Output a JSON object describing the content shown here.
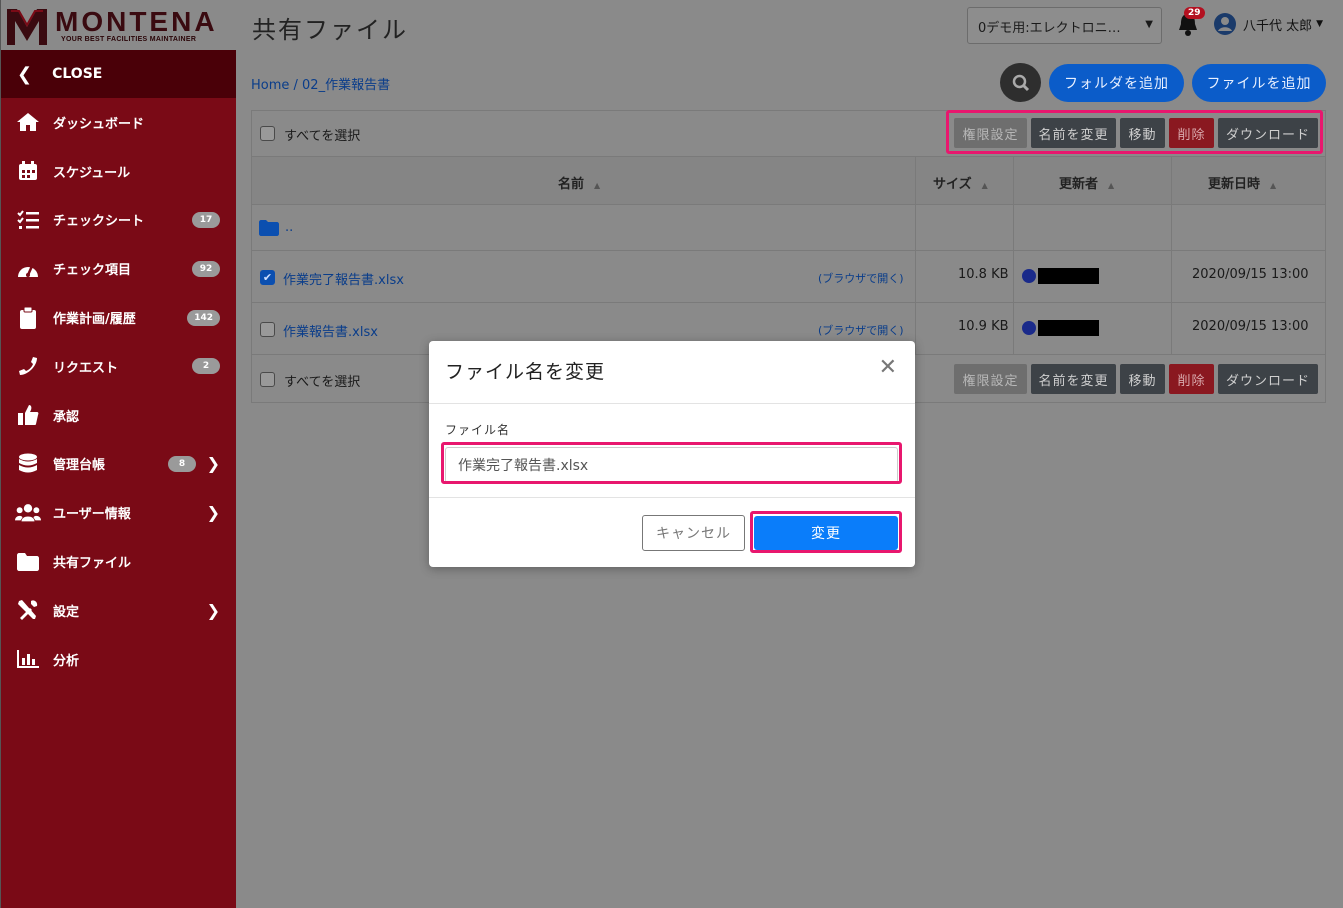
{
  "logo": {
    "name": "MONTENA",
    "tagline": "YOUR BEST FACILITIES MAINTAINER"
  },
  "sidebar": {
    "close_label": "CLOSE",
    "items": [
      {
        "label": "ダッシュボード",
        "icon": "home-icon",
        "badge": null,
        "chevron": false
      },
      {
        "label": "スケジュール",
        "icon": "calendar-icon",
        "badge": null,
        "chevron": false
      },
      {
        "label": "チェックシート",
        "icon": "checklist-icon",
        "badge": "17",
        "chevron": false
      },
      {
        "label": "チェック項目",
        "icon": "gauge-icon",
        "badge": "92",
        "chevron": false
      },
      {
        "label": "作業計画/履歴",
        "icon": "clipboard-icon",
        "badge": "142",
        "chevron": false
      },
      {
        "label": "リクエスト",
        "icon": "phone-icon",
        "badge": "2",
        "chevron": false
      },
      {
        "label": "承認",
        "icon": "thumbs-up-icon",
        "badge": null,
        "chevron": false
      },
      {
        "label": "管理台帳",
        "icon": "database-icon",
        "badge": "8",
        "chevron": true
      },
      {
        "label": "ユーザー情報",
        "icon": "users-icon",
        "badge": null,
        "chevron": true
      },
      {
        "label": "共有ファイル",
        "icon": "folder-icon",
        "badge": null,
        "chevron": false
      },
      {
        "label": "設定",
        "icon": "tools-icon",
        "badge": null,
        "chevron": true
      },
      {
        "label": "分析",
        "icon": "bar-chart-icon",
        "badge": null,
        "chevron": false
      }
    ]
  },
  "header": {
    "title": "共有ファイル",
    "site_select": "0デモ用:エレクトロニ…",
    "notification_count": "29",
    "user_name": "八千代 太郎"
  },
  "main": {
    "breadcrumb": "Home / 02_作業報告書",
    "add_folder_label": "フォルダを追加",
    "add_file_label": "ファイルを追加",
    "select_all_label": "すべてを選択",
    "toolbar": {
      "permission": "権限設定",
      "rename": "名前を変更",
      "move": "移動",
      "delete": "削除",
      "download": "ダウンロード"
    },
    "columns": {
      "name": "名前",
      "size": "サイズ",
      "updater": "更新者",
      "updated": "更新日時"
    },
    "parent_row": "..",
    "open_in_browser": "(ブラウザで開く)",
    "files": [
      {
        "name": "作業完了報告書.xlsx",
        "size": "10.8 KB",
        "updated": "2020/09/15 13:00",
        "checked": true
      },
      {
        "name": "作業報告書.xlsx",
        "size": "10.9 KB",
        "updated": "2020/09/15 13:00",
        "checked": false
      }
    ]
  },
  "modal": {
    "title": "ファイル名を変更",
    "field_label": "ファイル名",
    "field_value": "作業完了報告書.xlsx",
    "cancel_label": "キャンセル",
    "submit_label": "変更"
  },
  "colors": {
    "brand": "#7a0a16",
    "accent": "#0a7dfa",
    "highlight": "#e8176e"
  }
}
